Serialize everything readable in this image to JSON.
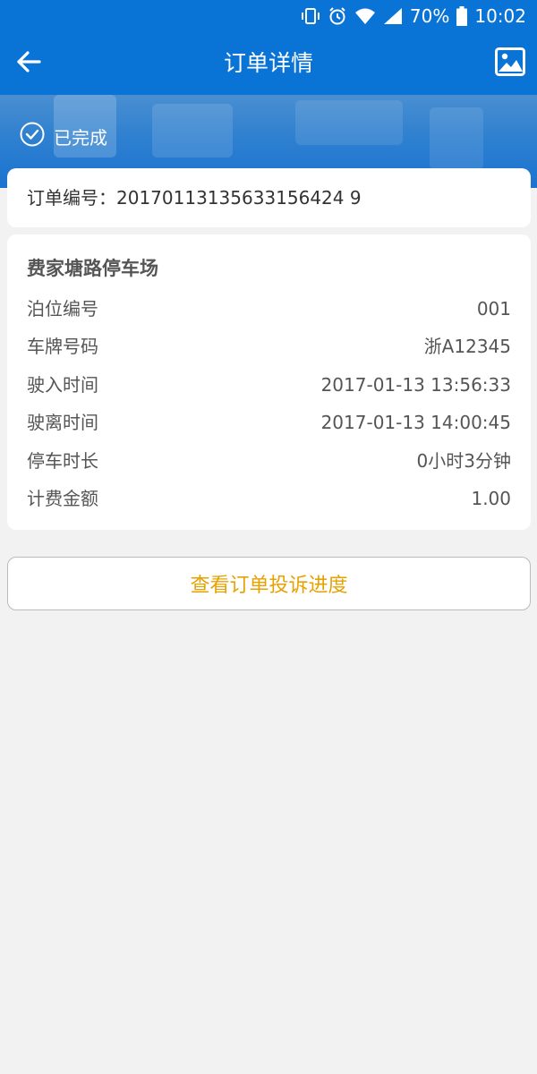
{
  "status_bar": {
    "battery": "70%",
    "time": "10:02",
    "icons": [
      "vibrate-icon",
      "alarm-icon",
      "wifi-icon",
      "signal-icon",
      "battery-icon"
    ]
  },
  "app_bar": {
    "title": "订单详情",
    "back_icon": "back-arrow-icon",
    "image_icon": "image-icon"
  },
  "order_status": {
    "icon": "check-circle-icon",
    "label": "已完成"
  },
  "order": {
    "number_label": "订单编号：20170113135633156424 9"
  },
  "parking": {
    "lot_name": "费家塘路停车场",
    "rows": [
      {
        "label": "泊位编号",
        "value": "001"
      },
      {
        "label": "车牌号码",
        "value": "浙A12345"
      },
      {
        "label": "驶入时间",
        "value": "2017-01-13 13:56:33"
      },
      {
        "label": "驶离时间",
        "value": "2017-01-13 14:00:45"
      },
      {
        "label": "停车时长",
        "value": "0小时3分钟"
      },
      {
        "label": "计费金额",
        "value": "1.00"
      }
    ]
  },
  "actions": {
    "complaint_label": "查看订单投诉进度"
  },
  "colors": {
    "primary": "#0a74d6",
    "accent": "#e6a200",
    "background": "#f2f2f2"
  }
}
